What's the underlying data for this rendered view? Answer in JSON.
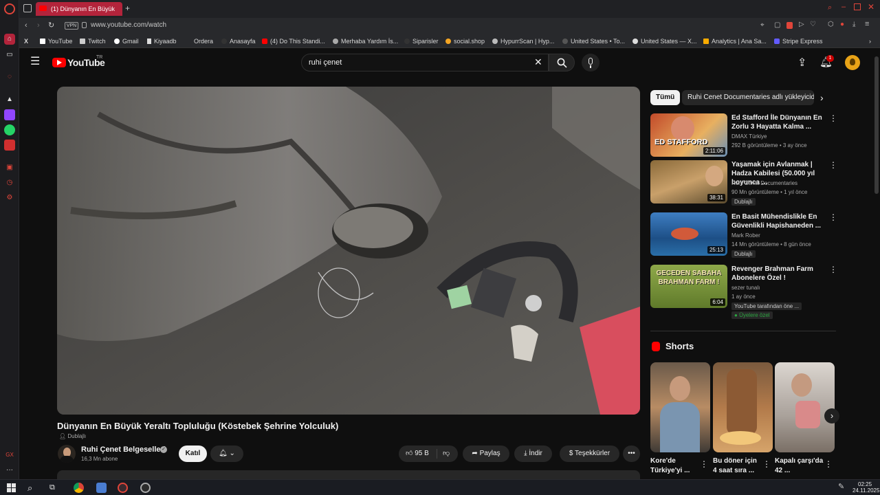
{
  "browser": {
    "tab_title": "(1) Dünyanın En Büyük",
    "url": "www.youtube.com/watch",
    "vpn_label": "VPN",
    "bookmarks": [
      "YouTube",
      "Twitch",
      "Gmail",
      "Kiyaadb",
      "Ordera",
      "Anasayfa",
      "(4) Do This Standi...",
      "Merhaba Yardım İs...",
      "Siparisler",
      "social.shop",
      "HypurrScan | Hyp...",
      "United States • To...",
      "United States — X...",
      "Analytics | Ana Sa...",
      "Stripe Express"
    ]
  },
  "header": {
    "logo_text": "YouTube",
    "logo_country": "TR",
    "search_query": "ruhi çenet",
    "notif_count": "1"
  },
  "video": {
    "title": "Dünyanın En Büyük Yeraltı Topluluğu (Köstebek Şehrine Yolculuk)",
    "dub_label": "Dublajlı",
    "channel": "Ruhi Çenet Belgeselleri",
    "subscribers": "16,3 Mn abone",
    "join_label": "Katıl",
    "likes": "95 B",
    "share_label": "Paylaş",
    "download_label": "İndir",
    "thanks_label": "Teşekkürler",
    "more": "•••"
  },
  "chips": [
    "Tümü",
    "Ruhi Cenet Documentaries adlı yükleyiciden"
  ],
  "recommendations": [
    {
      "title": "Ed Stafford İle Dünyanın En Zorlu 3 Hayatta Kalma ...",
      "channel": "DMAX Türkiye",
      "meta": "292 B görüntüleme • 3 ay önce",
      "duration": "2:11:06",
      "thumb_text": "ED STAFFORD",
      "badge": ""
    },
    {
      "title": "Yaşamak için Avlanmak | Hadza Kabilesi (50.000 yıl boyunca ...",
      "channel": "Ruhi Cenet Documentaries",
      "meta": "90 Mn görüntüleme • 1 yıl önce",
      "duration": "38:31",
      "thumb_text": "",
      "badge": "Dublajlı"
    },
    {
      "title": "En Basit Mühendislikle En Güvenlikli Hapishaneden ...",
      "channel": "Mark Rober",
      "meta": "14 Mn görüntüleme • 8 gün önce",
      "duration": "25:13",
      "thumb_text": "",
      "badge": "Dublajlı"
    },
    {
      "title": "Revenger Brahman Farm Abonelere Özel !",
      "channel": "sezer tunalı",
      "meta": "1 ay önce",
      "duration": "6:04",
      "thumb_text": "GECEDEN SABAHA BRAHMAN FARM !",
      "badge": "YouTube tarafından öne ...",
      "badge2": "Üyelere özel"
    }
  ],
  "shorts": {
    "title": "Shorts",
    "items": [
      {
        "title": "Kore'de Türkiye'yi ..."
      },
      {
        "title": "Bu döner için 4 saat sıra ..."
      },
      {
        "title": "Kapalı çarşı'da 42 ..."
      }
    ]
  },
  "taskbar": {
    "time": "02:25",
    "date": "24.11.2025"
  },
  "colors": {
    "yt_red": "#ff0000",
    "tab_red": "#b3243b",
    "bg": "#0f0f0f",
    "members_green": "#2ba640"
  }
}
